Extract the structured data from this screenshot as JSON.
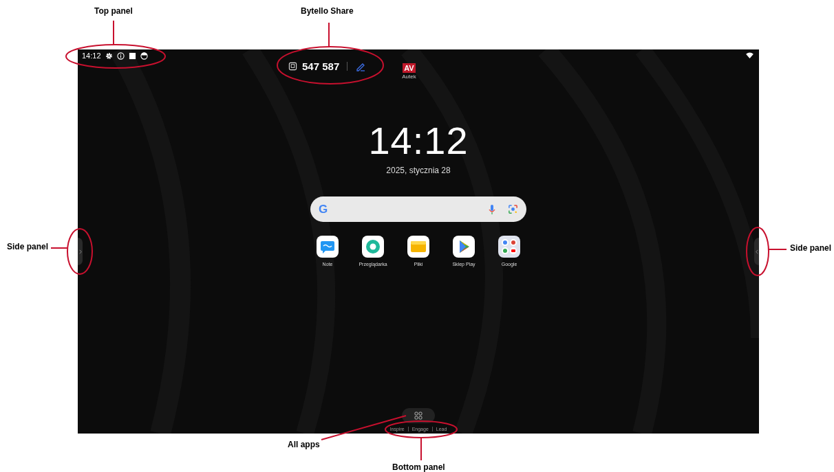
{
  "annotations": [
    {
      "label": "Top panel"
    },
    {
      "label": "Bytello Share"
    },
    {
      "label": "Side panel"
    },
    {
      "label": "Side panel"
    },
    {
      "label": "All apps"
    },
    {
      "label": "Bottom panel"
    }
  ],
  "screen": {
    "status_bar": {
      "time": "14:12"
    },
    "share": {
      "code": "547 587"
    },
    "logo": {
      "mark": "AV",
      "caption": "Autek"
    },
    "clock": {
      "time": "14:12",
      "date": "2025, stycznia 28"
    },
    "search": {
      "logo": "G"
    },
    "apps": [
      {
        "label": "Note",
        "kind": "note"
      },
      {
        "label": "Przeglądarka",
        "kind": "browser"
      },
      {
        "label": "Pliki",
        "kind": "files"
      },
      {
        "label": "Sklep Play",
        "kind": "store"
      },
      {
        "label": "Google",
        "kind": "folder"
      }
    ],
    "bottom_panel": {
      "modes": [
        "Inspire",
        "Engage",
        "Lead"
      ]
    }
  }
}
